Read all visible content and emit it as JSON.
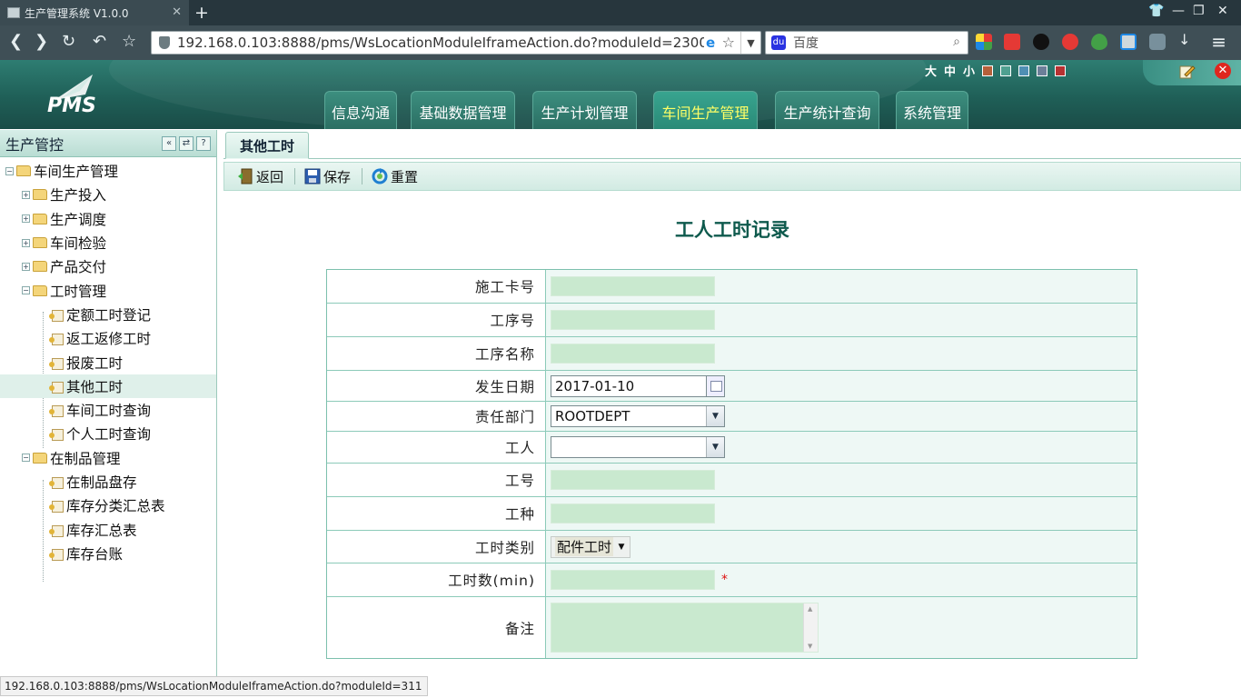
{
  "browser": {
    "tab_title": "生产管理系统 V1.0.0",
    "url": "192.168.0.103:8888/pms/WsLocationModuleIframeAction.do?moduleId=2300",
    "search_engine": "百度"
  },
  "app": {
    "logo_text": "PMS",
    "size_options": [
      "大",
      "中",
      "小"
    ],
    "theme_swatches": [
      "#b5603a",
      "#4fa090",
      "#4f8fb3",
      "#6c7f99",
      "#b73232"
    ],
    "main_nav": [
      {
        "label": "信息沟通"
      },
      {
        "label": "基础数据管理"
      },
      {
        "label": "生产计划管理"
      },
      {
        "label": "车间生产管理",
        "active": true
      },
      {
        "label": "生产统计查询"
      },
      {
        "label": "系统管理"
      }
    ]
  },
  "sidebar": {
    "title": "生产管控",
    "tree": [
      {
        "label": "车间生产管理",
        "level": 0,
        "type": "folder",
        "expanded": true
      },
      {
        "label": "生产投入",
        "level": 1,
        "type": "folder",
        "expanded": false
      },
      {
        "label": "生产调度",
        "level": 1,
        "type": "folder",
        "expanded": false
      },
      {
        "label": "车间检验",
        "level": 1,
        "type": "folder",
        "expanded": false
      },
      {
        "label": "产品交付",
        "level": 1,
        "type": "folder",
        "expanded": false
      },
      {
        "label": "工时管理",
        "level": 1,
        "type": "folder",
        "expanded": true
      },
      {
        "label": "定额工时登记",
        "level": 2,
        "type": "leaf"
      },
      {
        "label": "返工返修工时",
        "level": 2,
        "type": "leaf"
      },
      {
        "label": "报废工时",
        "level": 2,
        "type": "leaf"
      },
      {
        "label": "其他工时",
        "level": 2,
        "type": "leaf",
        "selected": true
      },
      {
        "label": "车间工时查询",
        "level": 2,
        "type": "leaf"
      },
      {
        "label": "个人工时查询",
        "level": 2,
        "type": "leaf"
      },
      {
        "label": "在制品管理",
        "level": 1,
        "type": "folder",
        "expanded": true
      },
      {
        "label": "在制品盘存",
        "level": 2,
        "type": "leaf"
      },
      {
        "label": "库存分类汇总表",
        "level": 2,
        "type": "leaf"
      },
      {
        "label": "库存汇总表",
        "level": 2,
        "type": "leaf"
      },
      {
        "label": "库存台账",
        "level": 2,
        "type": "leaf"
      }
    ]
  },
  "content": {
    "tab_label": "其他工时",
    "toolbar": {
      "back_label": "返回",
      "save_label": "保存",
      "reset_label": "重置"
    },
    "form_title": "工人工时记录",
    "fields": {
      "card_no": {
        "label": "施工卡号",
        "value": ""
      },
      "process_no": {
        "label": "工序号",
        "value": ""
      },
      "process_name": {
        "label": "工序名称",
        "value": ""
      },
      "date": {
        "label": "发生日期",
        "value": "2017-01-10"
      },
      "dept": {
        "label": "责任部门",
        "value": "ROOTDEPT"
      },
      "worker": {
        "label": "工人",
        "value": ""
      },
      "worker_no": {
        "label": "工号",
        "value": ""
      },
      "work_type": {
        "label": "工种",
        "value": ""
      },
      "hour_type": {
        "label": "工时类别",
        "value": "配件工时"
      },
      "minutes": {
        "label": "工时数(min)",
        "value": "",
        "required_mark": "*"
      },
      "remark": {
        "label": "备注",
        "value": ""
      }
    }
  },
  "status_bar": {
    "link_preview": "192.168.0.103:8888/pms/WsLocationModuleIframeAction.do?moduleId=311"
  }
}
